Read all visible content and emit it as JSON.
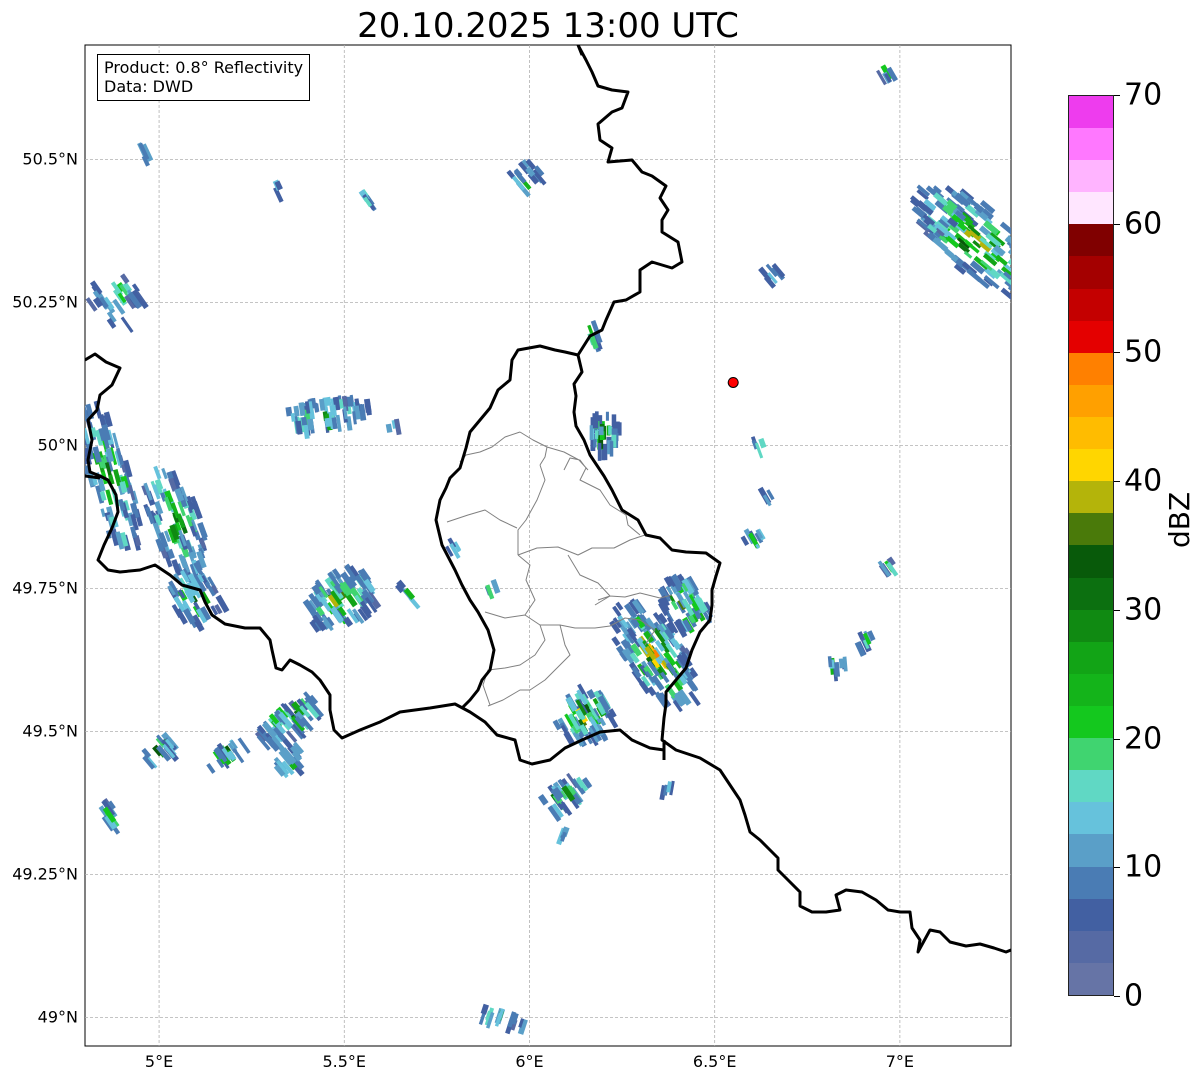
{
  "title": "20.10.2025 13:00 UTC",
  "info": {
    "product": "Product: 0.8° Reflectivity",
    "source": "Data: DWD"
  },
  "axes": {
    "lon_range": [
      4.8,
      7.3
    ],
    "lat_range": [
      48.95,
      50.7
    ],
    "lat_ticks": [
      {
        "value": 50.5,
        "label": "50.5°N"
      },
      {
        "value": 50.25,
        "label": "50.25°N"
      },
      {
        "value": 50.0,
        "label": "50°N"
      },
      {
        "value": 49.75,
        "label": "49.75°N"
      },
      {
        "value": 49.5,
        "label": "49.5°N"
      },
      {
        "value": 49.25,
        "label": "49.25°N"
      },
      {
        "value": 49.0,
        "label": "49°N"
      }
    ],
    "lon_ticks": [
      {
        "value": 5.0,
        "label": "5°E"
      },
      {
        "value": 5.5,
        "label": "5.5°E"
      },
      {
        "value": 6.0,
        "label": "6°E"
      },
      {
        "value": 6.5,
        "label": "6.5°E"
      },
      {
        "value": 7.0,
        "label": "7°E"
      }
    ],
    "grid": true
  },
  "marker": {
    "lon": 6.55,
    "lat": 50.11,
    "color": "#ff0000"
  },
  "colorbar": {
    "label": "dBZ",
    "ticks": [
      "0",
      "10",
      "20",
      "30",
      "40",
      "50",
      "60",
      "70"
    ],
    "range": [
      0,
      70
    ],
    "colors": [
      "#6674a6",
      "#566aa4",
      "#4260a2",
      "#4a7cb4",
      "#5a9fc8",
      "#66c2dc",
      "#60d8c4",
      "#40d470",
      "#14c81e",
      "#14b41a",
      "#12a416",
      "#108a12",
      "#0c7010",
      "#085a0a",
      "#4a7a0a",
      "#b4b40a",
      "#ffd600",
      "#ffbc00",
      "#ffa000",
      "#ff8000",
      "#e40000",
      "#c40000",
      "#a40000",
      "#800000",
      "#ffe6ff",
      "#ffb4ff",
      "#ff78ff",
      "#ee3cee"
    ]
  },
  "chart_data": {
    "type": "map",
    "title": "20.10.2025 13:00 UTC",
    "product": "0.8° Reflectivity",
    "unit": "dBZ",
    "value_range": [
      0,
      70
    ],
    "echo_regions": [
      {
        "lon": 7.2,
        "lat": 50.37,
        "max_dbz": 30
      },
      {
        "lon": 6.39,
        "lat": 49.65,
        "max_dbz": 45
      },
      {
        "lon": 6.42,
        "lat": 49.74,
        "max_dbz": 42
      },
      {
        "lon": 5.47,
        "lat": 49.74,
        "max_dbz": 25
      },
      {
        "lon": 6.19,
        "lat": 50.01,
        "max_dbz": 22
      },
      {
        "lon": 5.35,
        "lat": 49.53,
        "max_dbz": 25
      },
      {
        "lon": 6.09,
        "lat": 49.5,
        "max_dbz": 25
      },
      {
        "lon": 5.0,
        "lat": 49.85,
        "max_dbz": 15
      }
    ]
  }
}
